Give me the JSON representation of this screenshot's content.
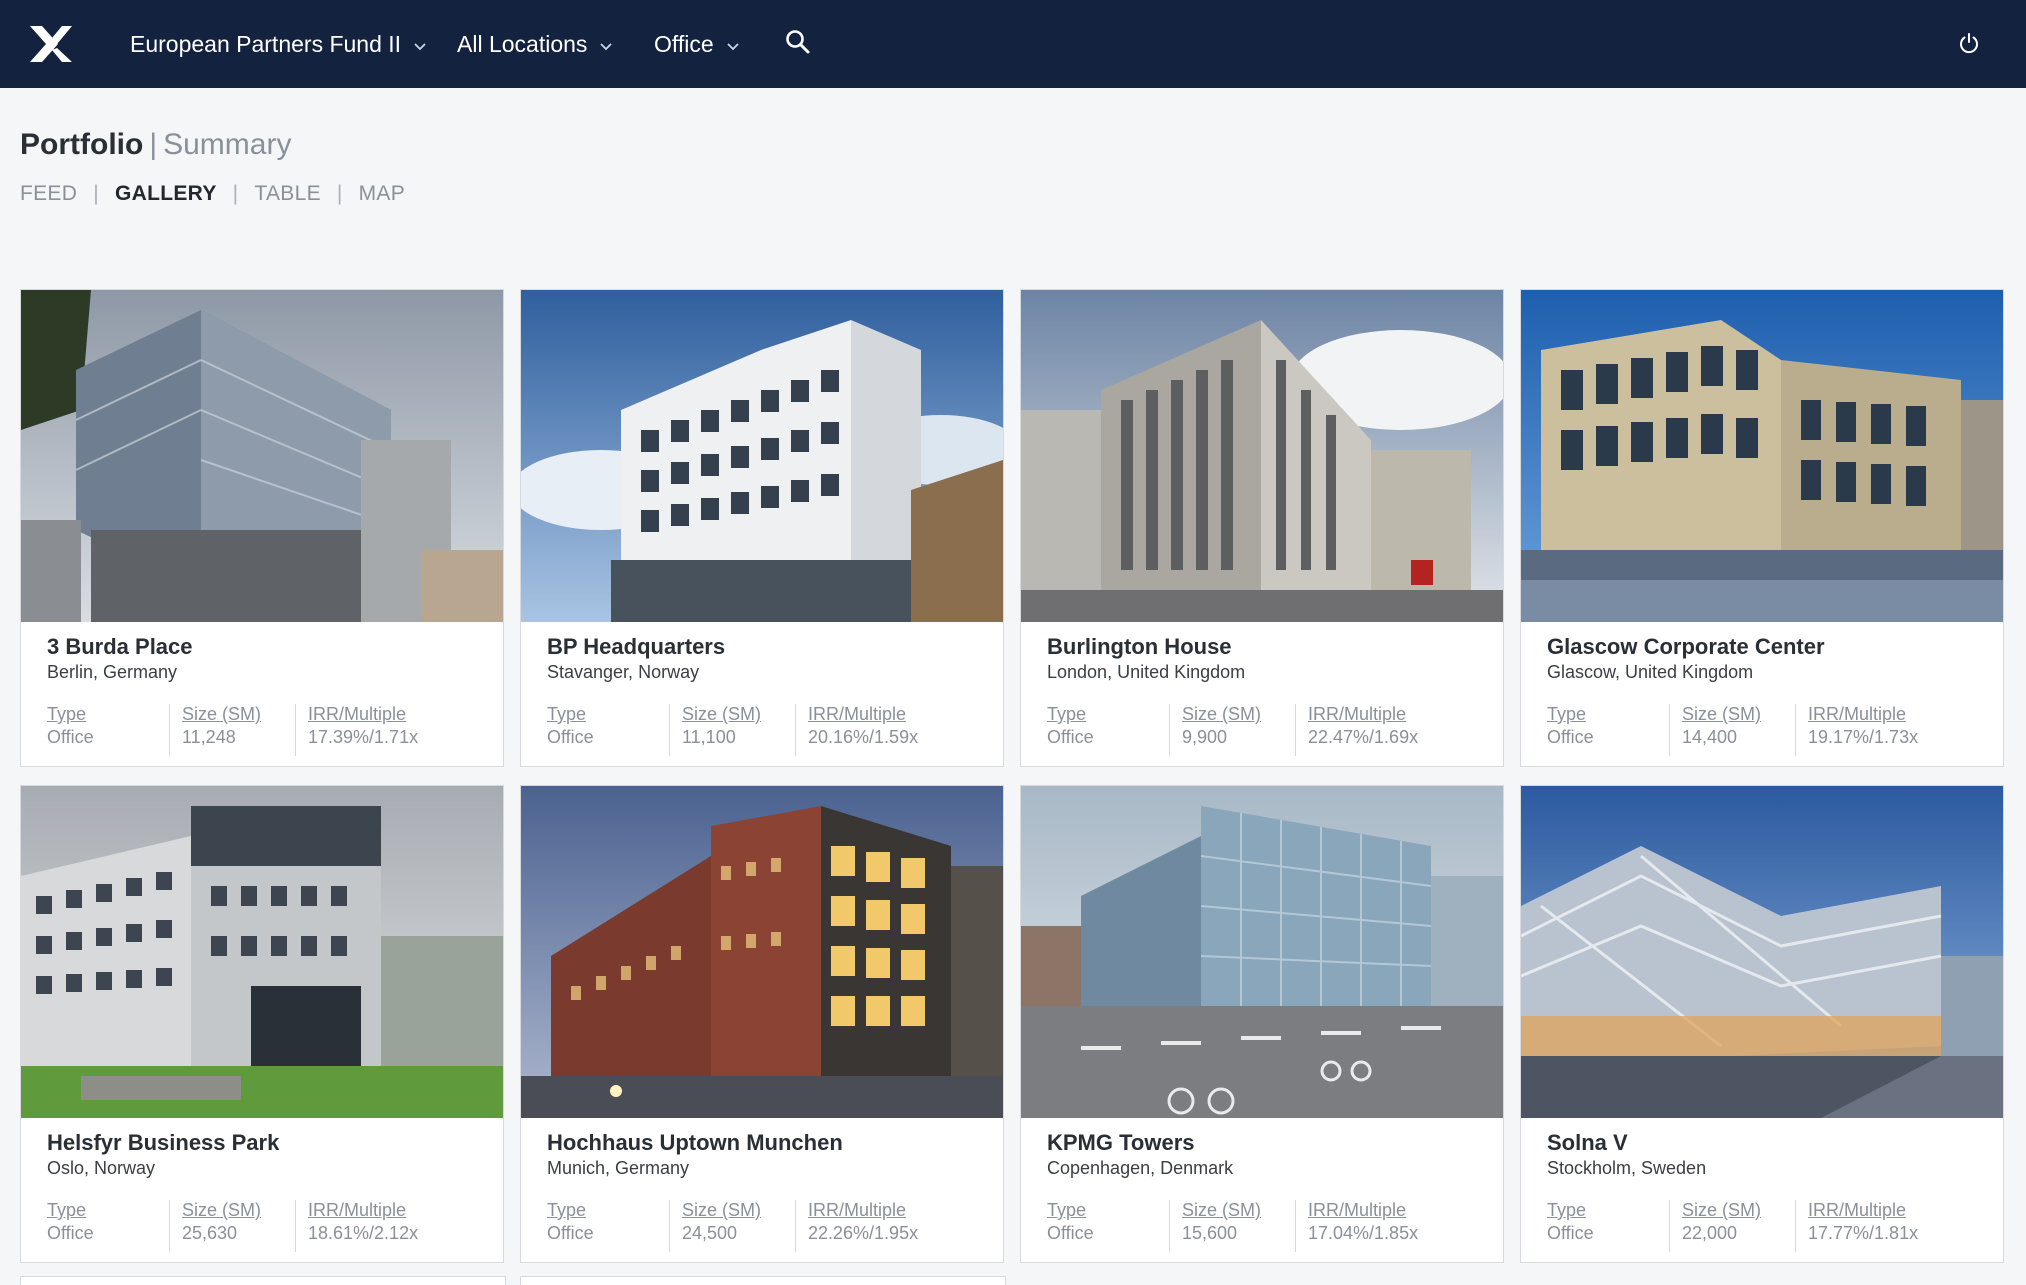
{
  "nav": {
    "fund": "European Partners Fund II",
    "location": "All Locations",
    "type": "Office"
  },
  "header": {
    "title": "Portfolio",
    "separator": "|",
    "subtitle": "Summary"
  },
  "view_tabs": {
    "feed": "FEED",
    "gallery": "GALLERY",
    "table": "TABLE",
    "map": "MAP",
    "separator": "|",
    "active": "GALLERY"
  },
  "colors": {
    "topbar": "#13223f",
    "background": "#f5f6f8",
    "card_border": "#d6d9de",
    "muted_text": "#8a9099"
  },
  "icons": {
    "logo": "x-logo-icon",
    "dropdown": "chevron-down-icon",
    "search": "search-icon",
    "power": "power-icon"
  },
  "stat_labels": {
    "type": "Type",
    "size": "Size (SM)",
    "irr": "IRR/Multiple"
  },
  "properties": [
    {
      "name": "3 Burda Place",
      "location": "Berlin, Germany",
      "type": "Office",
      "size": "11,248",
      "irr": "17.39%/1.71x"
    },
    {
      "name": "BP Headquarters",
      "location": "Stavanger, Norway",
      "type": "Office",
      "size": "11,100",
      "irr": "20.16%/1.59x"
    },
    {
      "name": "Burlington House",
      "location": "London, United Kingdom",
      "type": "Office",
      "size": "9,900",
      "irr": "22.47%/1.69x"
    },
    {
      "name": "Glascow Corporate Center",
      "location": "Glascow, United Kingdom",
      "type": "Office",
      "size": "14,400",
      "irr": "19.17%/1.73x"
    },
    {
      "name": "Helsfyr Business Park",
      "location": "Oslo, Norway",
      "type": "Office",
      "size": "25,630",
      "irr": "18.61%/2.12x"
    },
    {
      "name": "Hochhaus Uptown Munchen",
      "location": "Munich, Germany",
      "type": "Office",
      "size": "24,500",
      "irr": "22.26%/1.95x"
    },
    {
      "name": "KPMG Towers",
      "location": "Copenhagen, Denmark",
      "type": "Office",
      "size": "15,600",
      "irr": "17.04%/1.85x"
    },
    {
      "name": "Solna V",
      "location": "Stockholm, Sweden",
      "type": "Office",
      "size": "22,000",
      "irr": "17.77%/1.81x"
    }
  ]
}
